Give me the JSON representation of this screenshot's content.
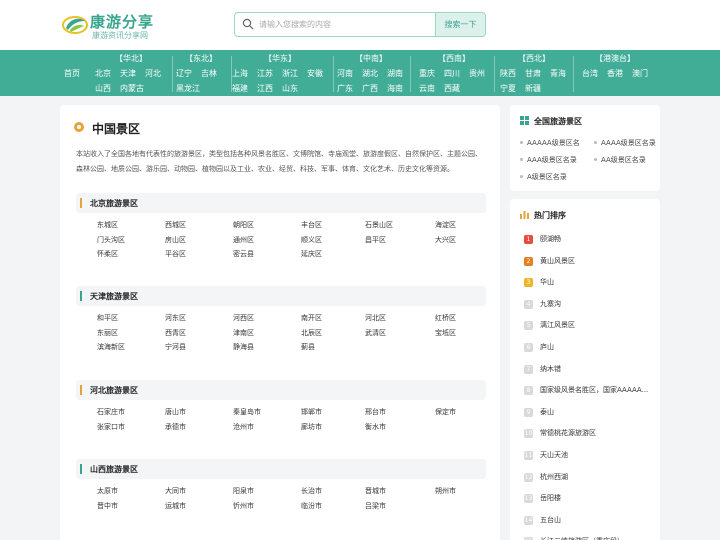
{
  "header": {
    "logo_title": "康游分享",
    "logo_subtitle": "康游资讯分享网",
    "search_placeholder": "请输入您搜索的内容",
    "search_button": "搜索一下"
  },
  "nav": {
    "home": "首页",
    "regions": [
      {
        "title": "【华北】",
        "row1": [
          "北京",
          "天津",
          "河北"
        ],
        "row2": [
          "山西",
          "内蒙古"
        ]
      },
      {
        "title": "【东北】",
        "row1": [
          "辽宁",
          "吉林"
        ],
        "row2": [
          "黑龙江"
        ]
      },
      {
        "title": "【华东】",
        "row1": [
          "上海",
          "江苏",
          "浙江",
          "安徽"
        ],
        "row2": [
          "福建",
          "江西",
          "山东"
        ]
      },
      {
        "title": "【中南】",
        "row1": [
          "河南",
          "湖北",
          "湖南"
        ],
        "row2": [
          "广东",
          "广西",
          "海南"
        ]
      },
      {
        "title": "【西南】",
        "row1": [
          "重庆",
          "四川",
          "贵州"
        ],
        "row2": [
          "云南",
          "西藏"
        ]
      },
      {
        "title": "【西北】",
        "row1": [
          "陕西",
          "甘肃",
          "青海"
        ],
        "row2": [
          "宁夏",
          "新疆"
        ]
      },
      {
        "title": "【港澳台】",
        "row1": [
          "台湾",
          "香港",
          "澳门"
        ],
        "row2": []
      }
    ]
  },
  "main": {
    "title": "中国景区",
    "intro": "本站收入了全国各地有代表性的旅游景区，类型包括各种风景名胜区、文博院馆、寺庙观堂、旅游度假区、自然保护区、主题公园、森林公园、地质公园、游乐园、动物园、植物园以及工业、农业、经贸、科技、军事、体育、文化艺术、历史文化等资源。",
    "sections": [
      {
        "name": "北京旅游景区",
        "bar_color": "#e6a23c",
        "cities": [
          "东城区",
          "西城区",
          "朝阳区",
          "丰台区",
          "石景山区",
          "海淀区",
          "门头沟区",
          "房山区",
          "通州区",
          "顺义区",
          "昌平区",
          "大兴区",
          "怀柔区",
          "平谷区",
          "密云县",
          "延庆区"
        ]
      },
      {
        "name": "天津旅游景区",
        "bar_color": "#3aa58e",
        "cities": [
          "和平区",
          "河东区",
          "河西区",
          "南开区",
          "河北区",
          "红桥区",
          "东丽区",
          "西青区",
          "津南区",
          "北辰区",
          "武清区",
          "宝坻区",
          "滨海新区",
          "宁河县",
          "静海县",
          "蓟县"
        ]
      },
      {
        "name": "河北旅游景区",
        "bar_color": "#e6a23c",
        "cities": [
          "石家庄市",
          "唐山市",
          "秦皇岛市",
          "邯郸市",
          "邢台市",
          "保定市",
          "张家口市",
          "承德市",
          "沧州市",
          "廊坊市",
          "衡水市"
        ]
      },
      {
        "name": "山西旅游景区",
        "bar_color": "#3aa58e",
        "cities": [
          "太原市",
          "大同市",
          "阳泉市",
          "长治市",
          "晋城市",
          "朔州市",
          "晋中市",
          "运城市",
          "忻州市",
          "临汾市",
          "吕梁市"
        ]
      }
    ]
  },
  "sidebar": {
    "levels_title": "全国旅游景区",
    "levels": [
      "AAAAA级景区名",
      "AAAA级景区名录",
      "AAA级景区名录",
      "AA级景区名录",
      "A级景区名录"
    ],
    "hot_title": "热门排序",
    "hot": [
      "颐湖畅",
      "黄山风景区",
      "华山",
      "九寨沟",
      "漓江风景区",
      "庐山",
      "纳木错",
      "国家级风景名胜区，国家AAAAA...",
      "泰山",
      "常德桃花源旅游区",
      "天山天池",
      "杭州西湖",
      "岳阳楼",
      "五台山",
      "长江三峡旅游区（重庆段）"
    ],
    "hot_colors": [
      "#e74c3c",
      "#e67e22",
      "#f0b429"
    ]
  }
}
